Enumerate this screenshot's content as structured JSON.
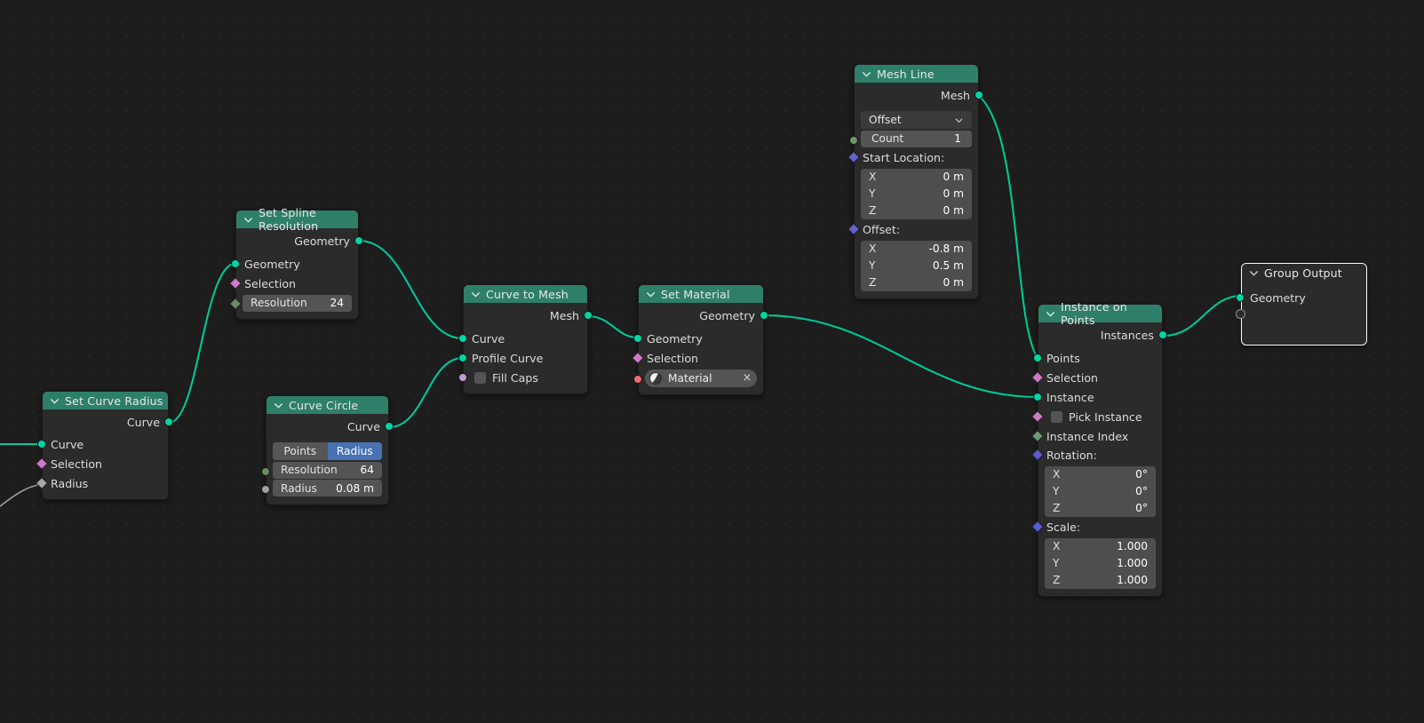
{
  "editor": {
    "name": "blender-geometry-node-editor",
    "background": "#1d1d1d",
    "link_color": "#00c896",
    "header_color": "#2e7f69"
  },
  "socket_colors": {
    "geometry": "#00d6a3",
    "boolean": "#cc7ac6",
    "integer": "#598c5c",
    "vector": "#6363c7",
    "material": "#ea6e6e",
    "float": "#a1a1a1",
    "unconnected": "#909090"
  },
  "nodes": [
    {
      "id": "set_curve_radius",
      "title": "Set Curve Radius",
      "outputs": [
        {
          "label": "Curve",
          "type": "geometry"
        }
      ],
      "inputs": [
        {
          "label": "Curve",
          "type": "geometry"
        },
        {
          "label": "Selection",
          "type": "boolean"
        },
        {
          "label": "Radius",
          "type": "float"
        }
      ]
    },
    {
      "id": "set_spline_resolution",
      "title": "Set Spline Resolution",
      "outputs": [
        {
          "label": "Geometry",
          "type": "geometry"
        }
      ],
      "inputs": [
        {
          "label": "Geometry",
          "type": "geometry"
        },
        {
          "label": "Selection",
          "type": "boolean"
        }
      ],
      "fields": [
        {
          "key": "Resolution",
          "value": "24",
          "type": "integer"
        }
      ]
    },
    {
      "id": "curve_circle",
      "title": "Curve Circle",
      "outputs": [
        {
          "label": "Curve",
          "type": "geometry"
        }
      ],
      "tabs": {
        "options": [
          "Points",
          "Radius"
        ],
        "selected": "Radius"
      },
      "fields": [
        {
          "key": "Resolution",
          "value": "64",
          "type": "integer"
        },
        {
          "key": "Radius",
          "value": "0.08 m",
          "type": "float"
        }
      ]
    },
    {
      "id": "curve_to_mesh",
      "title": "Curve to Mesh",
      "outputs": [
        {
          "label": "Mesh",
          "type": "geometry"
        }
      ],
      "inputs": [
        {
          "label": "Curve",
          "type": "geometry"
        },
        {
          "label": "Profile Curve",
          "type": "geometry"
        },
        {
          "label": "Fill Caps",
          "type": "boolean",
          "checkbox": true,
          "checked": false
        }
      ]
    },
    {
      "id": "set_material",
      "title": "Set Material",
      "outputs": [
        {
          "label": "Geometry",
          "type": "geometry"
        }
      ],
      "inputs": [
        {
          "label": "Geometry",
          "type": "geometry"
        },
        {
          "label": "Selection",
          "type": "boolean"
        }
      ],
      "material_field": {
        "name": "Material",
        "icon": "material-sphere-icon",
        "clear": "×",
        "type": "material"
      }
    },
    {
      "id": "mesh_line",
      "title": "Mesh Line",
      "outputs": [
        {
          "label": "Mesh",
          "type": "geometry"
        }
      ],
      "dropdown": {
        "value": "Offset"
      },
      "count": {
        "key": "Count",
        "value": "1",
        "type": "integer"
      },
      "groups": [
        {
          "label": "Start Location:",
          "type": "vector",
          "values": [
            {
              "key": "X",
              "value": "0 m"
            },
            {
              "key": "Y",
              "value": "0 m"
            },
            {
              "key": "Z",
              "value": "0 m"
            }
          ]
        },
        {
          "label": "Offset:",
          "type": "vector",
          "values": [
            {
              "key": "X",
              "value": "-0.8 m"
            },
            {
              "key": "Y",
              "value": "0.5 m"
            },
            {
              "key": "Z",
              "value": "0 m"
            }
          ]
        }
      ]
    },
    {
      "id": "instance_on_points",
      "title": "Instance on Points",
      "outputs": [
        {
          "label": "Instances",
          "type": "geometry"
        }
      ],
      "inputs": [
        {
          "label": "Points",
          "type": "geometry"
        },
        {
          "label": "Selection",
          "type": "boolean"
        },
        {
          "label": "Instance",
          "type": "geometry"
        },
        {
          "label": "Pick Instance",
          "type": "boolean",
          "checkbox": true,
          "checked": false
        },
        {
          "label": "Instance Index",
          "type": "integer"
        }
      ],
      "groups": [
        {
          "label": "Rotation:",
          "type": "vector",
          "values": [
            {
              "key": "X",
              "value": "0°"
            },
            {
              "key": "Y",
              "value": "0°"
            },
            {
              "key": "Z",
              "value": "0°"
            }
          ]
        },
        {
          "label": "Scale:",
          "type": "vector",
          "values": [
            {
              "key": "X",
              "value": "1.000"
            },
            {
              "key": "Y",
              "value": "1.000"
            },
            {
              "key": "Z",
              "value": "1.000"
            }
          ]
        }
      ]
    },
    {
      "id": "group_output",
      "title": "Group Output",
      "active": true,
      "inputs": [
        {
          "label": "Geometry",
          "type": "geometry"
        },
        {
          "label": "",
          "type": "unconnected"
        }
      ]
    }
  ]
}
